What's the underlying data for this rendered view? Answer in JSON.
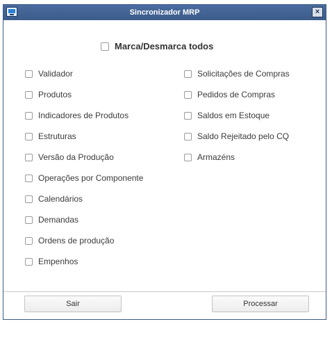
{
  "window": {
    "title": "Sincronizador MRP",
    "close_label": "×"
  },
  "master_checkbox": {
    "label": "Marca/Desmarca todos",
    "checked": false
  },
  "left_items": [
    {
      "label": "Validador",
      "checked": false
    },
    {
      "label": "Produtos",
      "checked": false
    },
    {
      "label": "Indicadores de Produtos",
      "checked": false
    },
    {
      "label": "Estruturas",
      "checked": false
    },
    {
      "label": "Versão da Produção",
      "checked": false
    },
    {
      "label": "Operações por Componente",
      "checked": false
    },
    {
      "label": "Calendários",
      "checked": false
    },
    {
      "label": "Demandas",
      "checked": false
    },
    {
      "label": "Ordens de produção",
      "checked": false
    },
    {
      "label": "Empenhos",
      "checked": false
    }
  ],
  "right_items": [
    {
      "label": "Solicitações de Compras",
      "checked": false
    },
    {
      "label": "Pedidos de Compras",
      "checked": false
    },
    {
      "label": "Saldos em Estoque",
      "checked": false
    },
    {
      "label": "Saldo Rejeitado pelo CQ",
      "checked": false
    },
    {
      "label": "Armazéns",
      "checked": false
    }
  ],
  "buttons": {
    "exit": "Sair",
    "process": "Processar"
  },
  "colors": {
    "titlebar": "#3f5f8f",
    "border": "#3b5a86"
  }
}
